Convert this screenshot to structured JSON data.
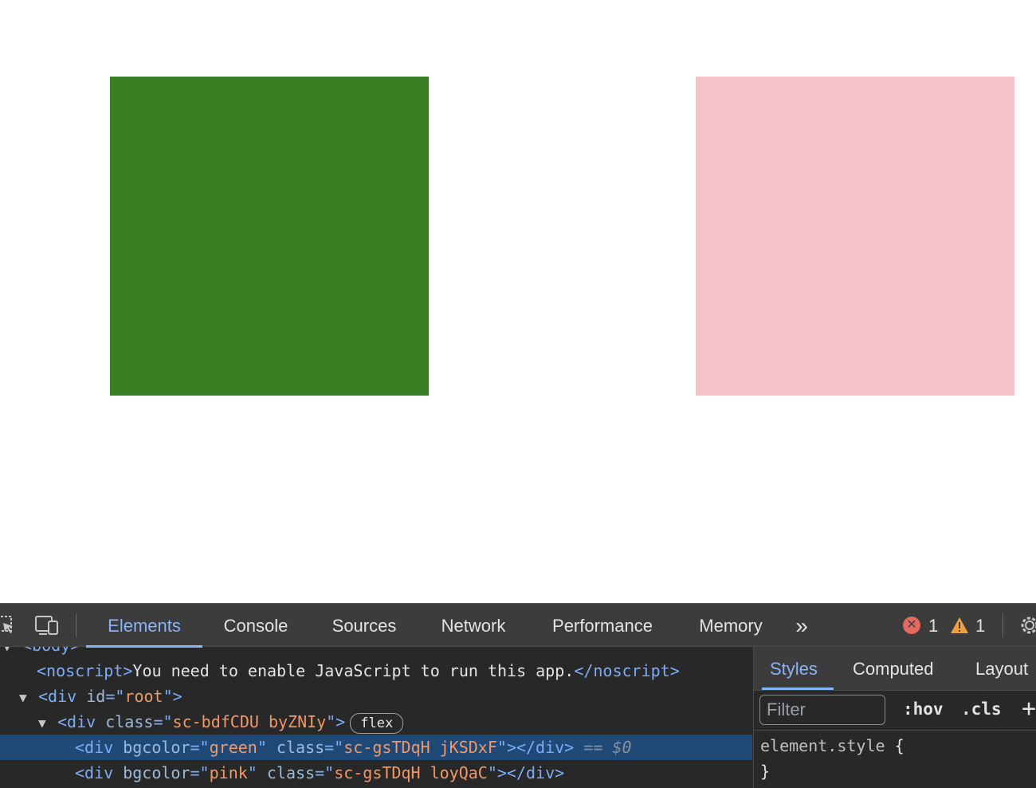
{
  "page": {
    "boxes": [
      {
        "name": "green",
        "color": "#387e22"
      },
      {
        "name": "pink",
        "color": "#f5c2cb"
      }
    ]
  },
  "devtools": {
    "tabs": [
      "Elements",
      "Console",
      "Sources",
      "Network",
      "Performance",
      "Memory"
    ],
    "more_tabs": "»",
    "errors": "1",
    "warnings": "1",
    "tree": {
      "body_tag": "<body>",
      "noscript_open": "<noscript>",
      "noscript_text": "You need to enable JavaScript to run this app.",
      "noscript_close": "</noscript>",
      "root_open": "<div",
      "root_attr": "id",
      "root_val": "root",
      "flex_div_open": "<div",
      "flex_div_attr": "class",
      "flex_div_val": "sc-bdfCDU byZNIy",
      "flex_badge": "flex",
      "child1_attr1": "bgcolor",
      "child1_val1": "green",
      "child1_attr2": "class",
      "child1_val2": "sc-gsTDqH jKSDxF",
      "child1_close": "></div>",
      "selected_marker": "== $0",
      "child2_attr1": "bgcolor",
      "child2_val1": "pink",
      "child2_attr2": "class",
      "child2_val2": "sc-gsTDqH loyQaC",
      "child2_close": "></div>"
    },
    "styles": {
      "tabs": [
        "Styles",
        "Computed",
        "Layout"
      ],
      "filter_placeholder": "Filter",
      "hov": ":hov",
      "cls": ".cls",
      "add": "+",
      "rule_selector": "element.style",
      "rule_open": "{",
      "rule_close": "}"
    }
  }
}
